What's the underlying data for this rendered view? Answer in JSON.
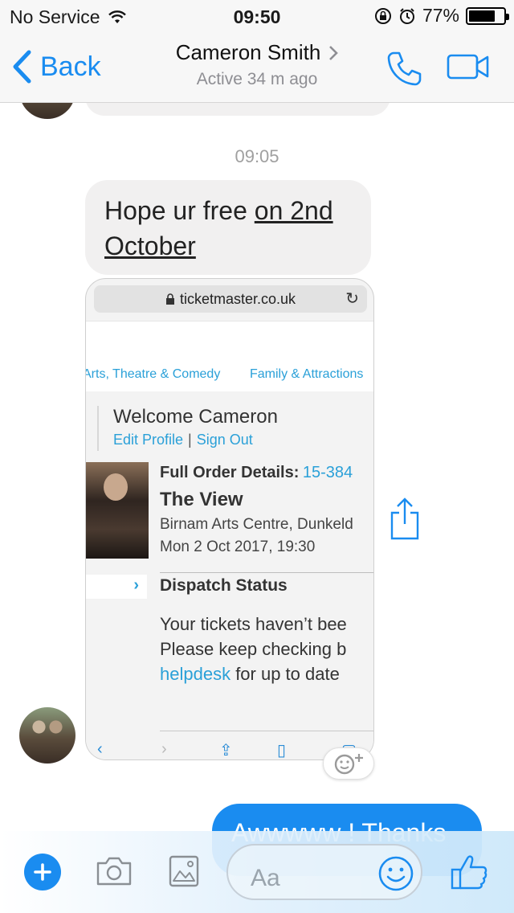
{
  "status_bar": {
    "carrier": "No Service",
    "time": "09:50",
    "battery": "77%",
    "battery_level": 0.77
  },
  "nav": {
    "back_label": "Back",
    "contact_name": "Cameron Smith",
    "active_status": "Active 34 m ago",
    "icons": [
      "chevron-left-icon",
      "chevron-right-icon",
      "phone-icon",
      "video-camera-icon"
    ]
  },
  "chat": {
    "timestamp": "09:05",
    "received_message_plain": "Hope ur free ",
    "received_message_link": "on 2nd October",
    "sent_message": "Awwwww ! Thanks"
  },
  "shared_screenshot": {
    "url": "ticketmaster.co.uk",
    "categories": [
      "Arts, Theatre & Comedy",
      "Family & Attractions"
    ],
    "welcome": "Welcome Cameron",
    "edit_profile": "Edit Profile",
    "separator": "|",
    "sign_out": "Sign Out",
    "order_label": "Full Order Details:",
    "order_number": "15-384",
    "event_title": "The View",
    "venue": "Birnam Arts Centre, Dunkeld",
    "date": "Mon 2 Oct 2017, 19:30",
    "dispatch_arrow": "›",
    "dispatch_title": "Dispatch Status",
    "dispatch_line1": "Your tickets haven’t bee",
    "dispatch_line2": "Please keep checking b",
    "helpdesk": "helpdesk",
    "dispatch_line3_rest": " for up to date"
  },
  "composer": {
    "placeholder": "Aa"
  },
  "colors": {
    "accent": "#1a8cf0",
    "link": "#2aa0d8",
    "bubble_received": "#f1f0f0"
  }
}
